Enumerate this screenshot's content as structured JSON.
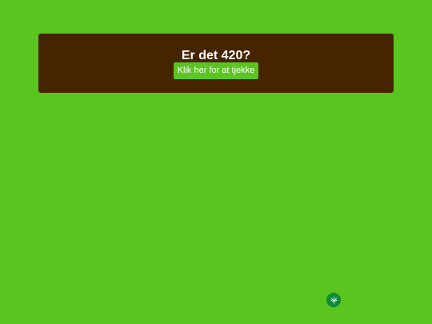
{
  "colors": {
    "page_background": "#5ac51e",
    "banner_background": "#462400",
    "button_background": "#5ac51e",
    "text": "#ffffff",
    "badge_background": "#0e8a3a"
  },
  "banner": {
    "title": "Er det 420?",
    "button_label": "Klik her for at tjekke"
  },
  "badge": {
    "icon": "cannabis-leaf-icon"
  }
}
